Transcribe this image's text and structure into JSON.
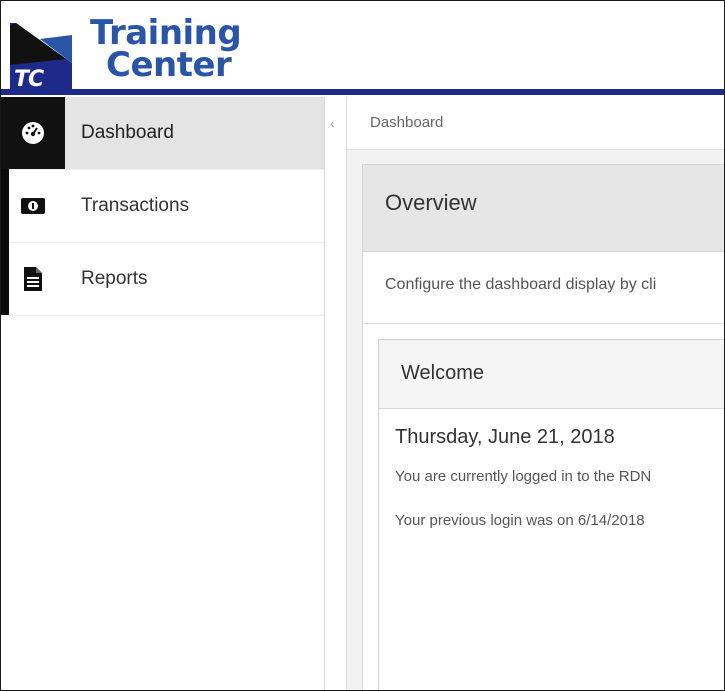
{
  "logo": {
    "line1": "Training",
    "line2": "Center",
    "badge": "TC"
  },
  "colors": {
    "brand_blue": "#2a55a7",
    "header_rule": "#1e2a8a",
    "sidebar_active_bg": "#e4e4e4",
    "sidebar_strip": "#0a0a0a"
  },
  "sidebar": {
    "items": [
      {
        "label": "Dashboard",
        "icon": "dashboard-gauge-icon",
        "active": true
      },
      {
        "label": "Transactions",
        "icon": "money-bill-icon",
        "active": false
      },
      {
        "label": "Reports",
        "icon": "document-icon",
        "active": false
      }
    ]
  },
  "rail": {
    "chevron": "‹"
  },
  "breadcrumb": {
    "current": "Dashboard"
  },
  "overview": {
    "title": "Overview",
    "description": "Configure the dashboard display by cli"
  },
  "welcome": {
    "title": "Welcome",
    "date": "Thursday, June 21, 2018",
    "line1": "You are currently logged in to the RDN",
    "line2": "Your previous login was on 6/14/2018"
  }
}
